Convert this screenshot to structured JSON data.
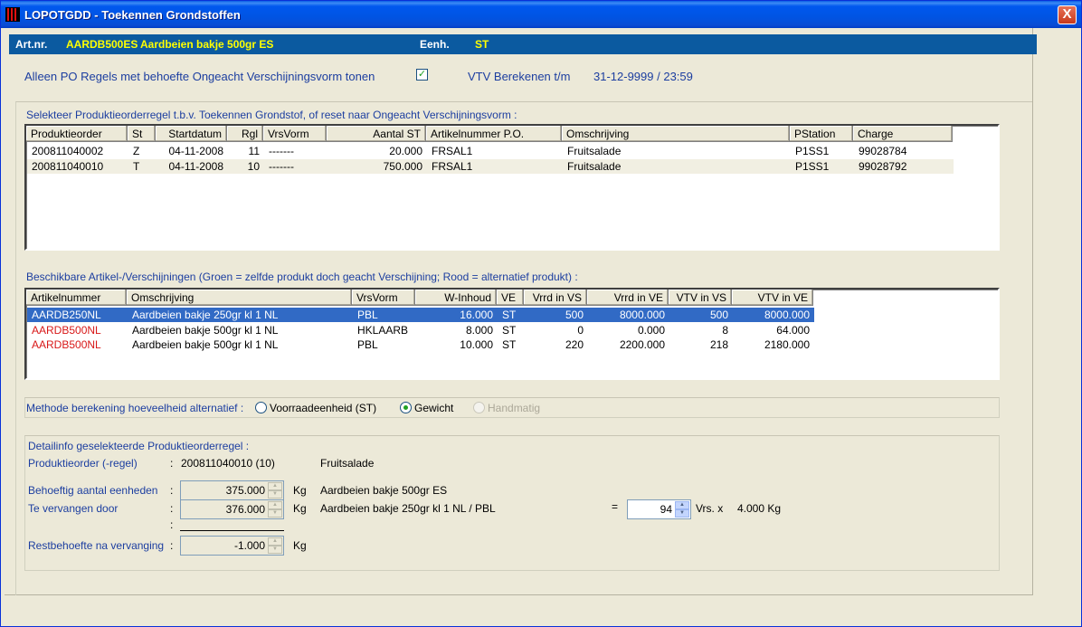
{
  "window": {
    "title": "LOPOTGDD - Toekennen Grondstoffen",
    "close": "X"
  },
  "article": {
    "label": "Art.nr.",
    "code": "AARDB500ES",
    "description": "Aardbeien bakje 500gr ES",
    "unit_label": "Eenh.",
    "unit": "ST"
  },
  "filter": {
    "label": "Alleen PO Regels met behoefte Ongeacht Verschijningsvorm tonen",
    "checked": true,
    "vtv_label": "VTV Berekenen t/m",
    "vtv_value": "31-12-9999 / 23:59"
  },
  "po_section": {
    "title": "Selekteer Produktieorderregel t.b.v. Toekennen Grondstof, of reset naar Ongeacht Verschijningsvorm :",
    "columns": [
      "Produktieorder",
      "St",
      "Startdatum",
      "Rgl",
      "VrsVorm",
      "Aantal ST",
      "Artikelnummer P.O.",
      "Omschrijving",
      "PStation",
      "Charge"
    ],
    "rows": [
      [
        "200811040002",
        "Z",
        "04-11-2008",
        "11",
        "-------",
        "20.000",
        "FRSAL1",
        "Fruitsalade",
        "P1SS1",
        "99028784"
      ],
      [
        "200811040010",
        "T",
        "04-11-2008",
        "10",
        "-------",
        "750.000",
        "FRSAL1",
        "Fruitsalade",
        "P1SS1",
        "99028792"
      ]
    ]
  },
  "avail_section": {
    "title": "Beschikbare Artikel-/Verschijningen (Groen = zelfde produkt doch geacht Verschijning; Rood = alternatief produkt) :",
    "columns": [
      "Artikelnummer",
      "Omschrijving",
      "VrsVorm",
      "W-Inhoud",
      "VE",
      "Vrrd in VS",
      "Vrrd in VE",
      "VTV in VS",
      "VTV in VE"
    ],
    "rows": [
      [
        "AARDB250NL",
        "Aardbeien bakje 250gr kl 1 NL",
        "PBL",
        "16.000",
        "ST",
        "500",
        "8000.000",
        "500",
        "8000.000"
      ],
      [
        "AARDB500NL",
        "Aardbeien bakje 500gr kl 1 NL",
        "HKLAARB",
        "8.000",
        "ST",
        "0",
        "0.000",
        "8",
        "64.000"
      ],
      [
        "AARDB500NL",
        "Aardbeien bakje 500gr kl 1 NL",
        "PBL",
        "10.000",
        "ST",
        "220",
        "2200.000",
        "218",
        "2180.000"
      ]
    ],
    "row_colors": [
      "#ffffff",
      "#d81818",
      "#d81818"
    ]
  },
  "method": {
    "label": "Methode berekening hoeveelheid alternatief :",
    "options": [
      "Voorraadeenheid (ST)",
      "Gewicht",
      "Handmatig"
    ],
    "selected": "Gewicht"
  },
  "detail": {
    "title": "Detailinfo geselekteerde Produktieorderregel :",
    "po_label": "Produktieorder (-regel)",
    "po_value": "200811040010 (10)",
    "po_desc": "Fruitsalade",
    "need_label": "Behoeftig aantal eenheden",
    "need_value": "375.000",
    "need_unit": "Kg",
    "need_desc": "Aardbeien bakje 500gr ES",
    "replace_label": "Te vervangen door",
    "replace_value": "376.000",
    "replace_unit": "Kg",
    "replace_desc": "Aardbeien bakje 250gr kl 1 NL / PBL",
    "equals": "=",
    "qty_value": "94",
    "qty_suffix": "Vrs.  x",
    "qty_weight": "4.000 Kg",
    "rest_label": "Restbehoefte na vervanging",
    "rest_value": "-1.000",
    "rest_unit": "Kg",
    "colon": ":"
  }
}
